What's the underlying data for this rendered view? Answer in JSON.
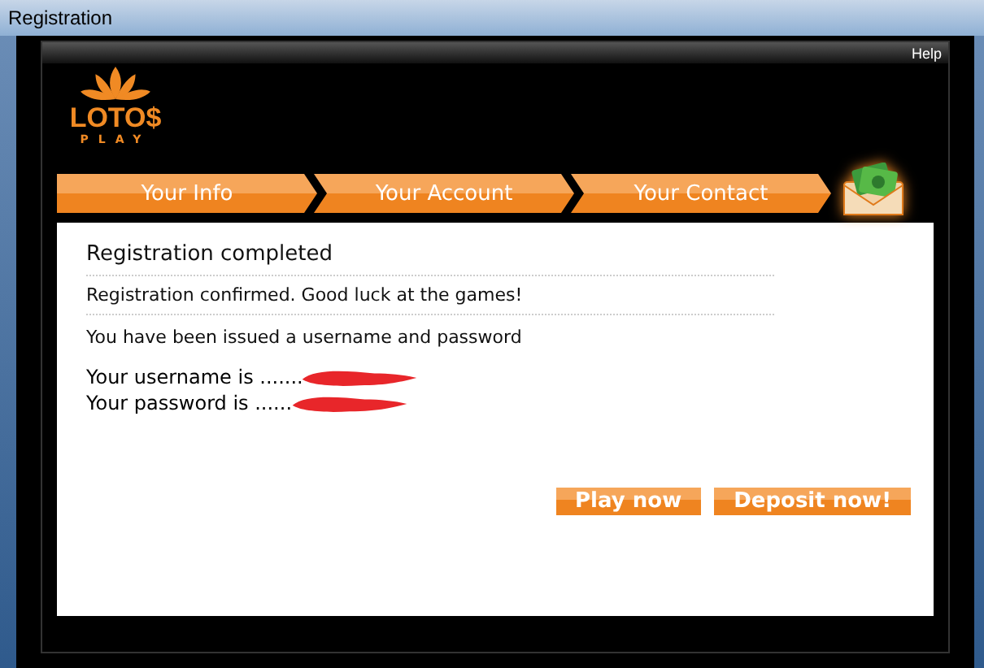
{
  "window": {
    "title": "Registration"
  },
  "header": {
    "help": "Help",
    "logo": {
      "name": "LOTO$",
      "tagline": "PLAY"
    }
  },
  "steps": [
    {
      "label": "Your Info"
    },
    {
      "label": "Your Account"
    },
    {
      "label": "Your Contact"
    }
  ],
  "content": {
    "heading": "Registration completed",
    "message": "Registration confirmed. Good luck at the games!",
    "note": "You have been issued a username and password",
    "credentials": [
      {
        "label": "Your username is .......",
        "redacted": true
      },
      {
        "label": "Your password is ......",
        "redacted": true
      }
    ]
  },
  "buttons": [
    {
      "label": "Play now"
    },
    {
      "label": "Deposit now!"
    }
  ]
}
